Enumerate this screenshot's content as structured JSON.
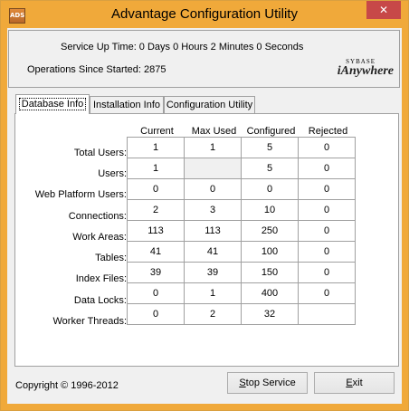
{
  "window": {
    "title": "Advantage Configuration Utility",
    "icon_label": "ADS",
    "close_glyph": "✕"
  },
  "status": {
    "uptime": "Service Up Time: 0 Days 0 Hours 2 Minutes 0 Seconds",
    "operations": "Operations Since Started: 2875"
  },
  "logo": {
    "small": "SYBASE",
    "big": "iAnywhere"
  },
  "tabs": [
    {
      "label": "Database Info",
      "active": true
    },
    {
      "label": "Installation Info",
      "active": false
    },
    {
      "label": "Configuration Utility",
      "active": false
    }
  ],
  "table": {
    "columns": [
      "Current",
      "Max Used",
      "Configured",
      "Rejected"
    ],
    "rows": [
      {
        "label": "Total Users:",
        "values": [
          "1",
          "1",
          "5",
          "0"
        ]
      },
      {
        "label": "Users:",
        "values": [
          "1",
          "",
          "5",
          "0"
        ]
      },
      {
        "label": "Web Platform Users:",
        "values": [
          "0",
          "0",
          "0",
          "0"
        ]
      },
      {
        "label": "Connections:",
        "values": [
          "2",
          "3",
          "10",
          "0"
        ]
      },
      {
        "label": "Work Areas:",
        "values": [
          "113",
          "113",
          "250",
          "0"
        ]
      },
      {
        "label": "Tables:",
        "values": [
          "41",
          "41",
          "100",
          "0"
        ]
      },
      {
        "label": "Index Files:",
        "values": [
          "39",
          "39",
          "150",
          "0"
        ]
      },
      {
        "label": "Data Locks:",
        "values": [
          "0",
          "1",
          "400",
          "0"
        ]
      },
      {
        "label": "Worker Threads:",
        "values": [
          "0",
          "2",
          "32",
          ""
        ]
      }
    ]
  },
  "footer": {
    "copyright": "Copyright © 1996-2012",
    "stop_button": {
      "mnemonic": "S",
      "rest": "top Service"
    },
    "exit_button": {
      "mnemonic": "E",
      "rest": "xit"
    }
  }
}
